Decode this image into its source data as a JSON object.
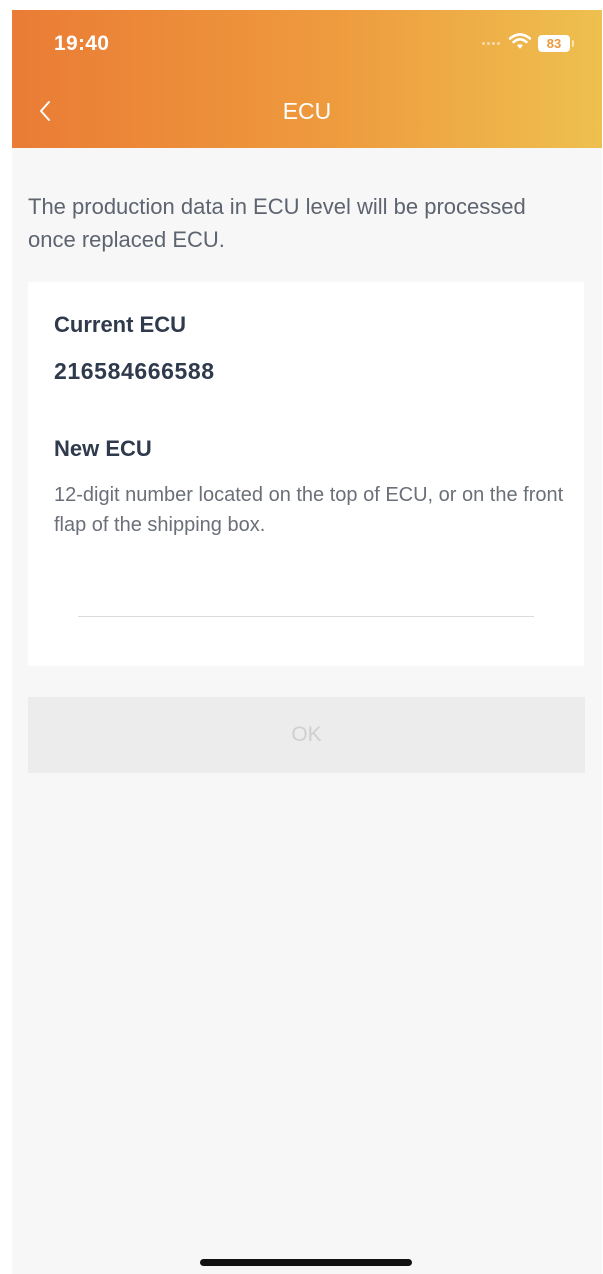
{
  "status_bar": {
    "time": "19:40",
    "battery_level": "83",
    "icons": [
      "signal-dots-icon",
      "wifi-icon",
      "battery-icon"
    ]
  },
  "nav": {
    "back_icon": "chevron-left-icon",
    "title": "ECU"
  },
  "intro_text": "The production data in ECU level will be processed once replaced ECU.",
  "current_ecu": {
    "label": "Current ECU",
    "value": "216584666588"
  },
  "new_ecu": {
    "label": "New ECU",
    "help": "12-digit number located on the top of ECU, or on the front flap of the shipping box.",
    "input_value": "",
    "input_placeholder": ""
  },
  "ok_button": {
    "label": "OK",
    "enabled": false
  },
  "colors": {
    "header_gradient_start": "#ea7c35",
    "header_gradient_end": "#eec04f",
    "background": "#f7f7f7",
    "text_primary": "#2f3a4c",
    "text_secondary": "#5d6470",
    "button_disabled_bg": "#ececec",
    "button_disabled_text": "#cfcfcf"
  }
}
